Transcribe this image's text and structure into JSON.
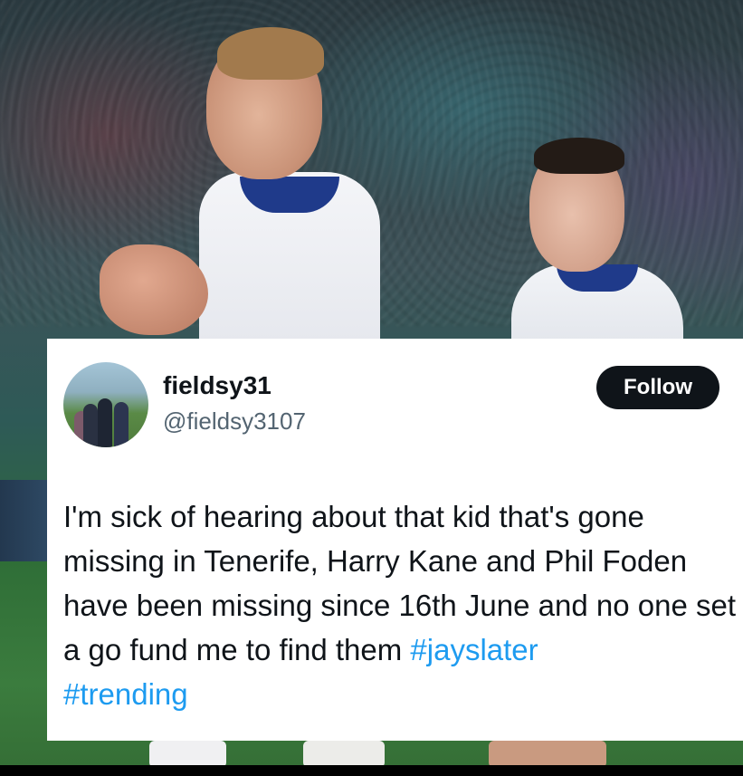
{
  "tweet": {
    "username": "fieldsy31",
    "handle": "@fieldsy3107",
    "follow_label": "Follow",
    "text_body": "I'm sick of hearing about that kid that's gone missing in Tenerife, Harry Kane and Phil Foden have been missing since 16th June and no one set a go fund me to find them ",
    "hashtags": [
      "#jayslater",
      "#trending"
    ]
  },
  "colors": {
    "follow_button": "#0f1419",
    "hashtag": "#1d9bf0",
    "handle": "#536471"
  },
  "icons": {
    "avatar": "profile-photo"
  }
}
